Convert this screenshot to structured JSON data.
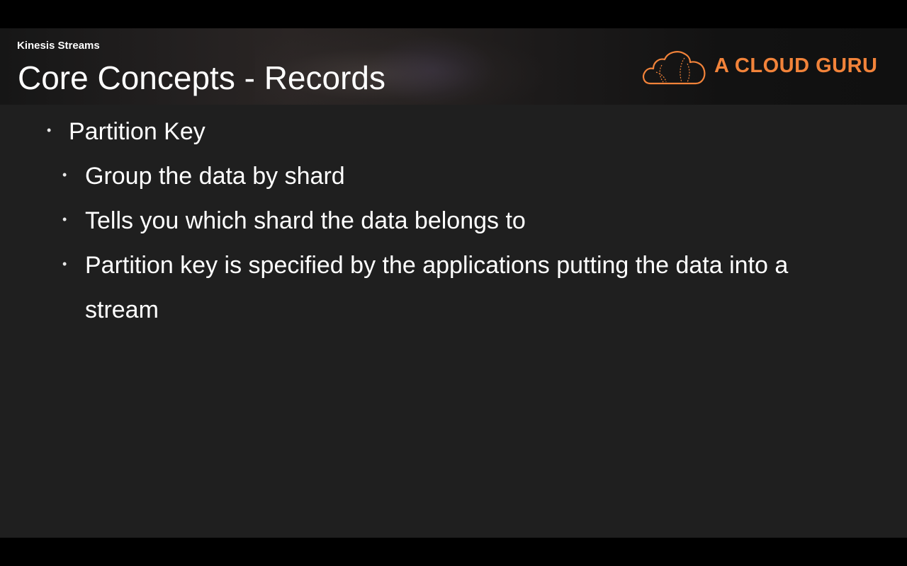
{
  "header": {
    "section_label": "Kinesis Streams",
    "title": "Core Concepts - Records",
    "logo_text": "A CLOUD GURU",
    "logo_color": "#f2833a"
  },
  "bullets": [
    {
      "level": 1,
      "text": "Partition Key"
    },
    {
      "level": 2,
      "text": "Group the data by shard"
    },
    {
      "level": 2,
      "text": "Tells you which shard the data belongs to"
    },
    {
      "level": 2,
      "text": "Partition key is specified by the applications putting the data into a",
      "continuation": "stream"
    }
  ],
  "bullet_glyph": "•",
  "colors": {
    "background": "#1f1f1f",
    "text": "#ffffff",
    "accent": "#f2833a"
  }
}
